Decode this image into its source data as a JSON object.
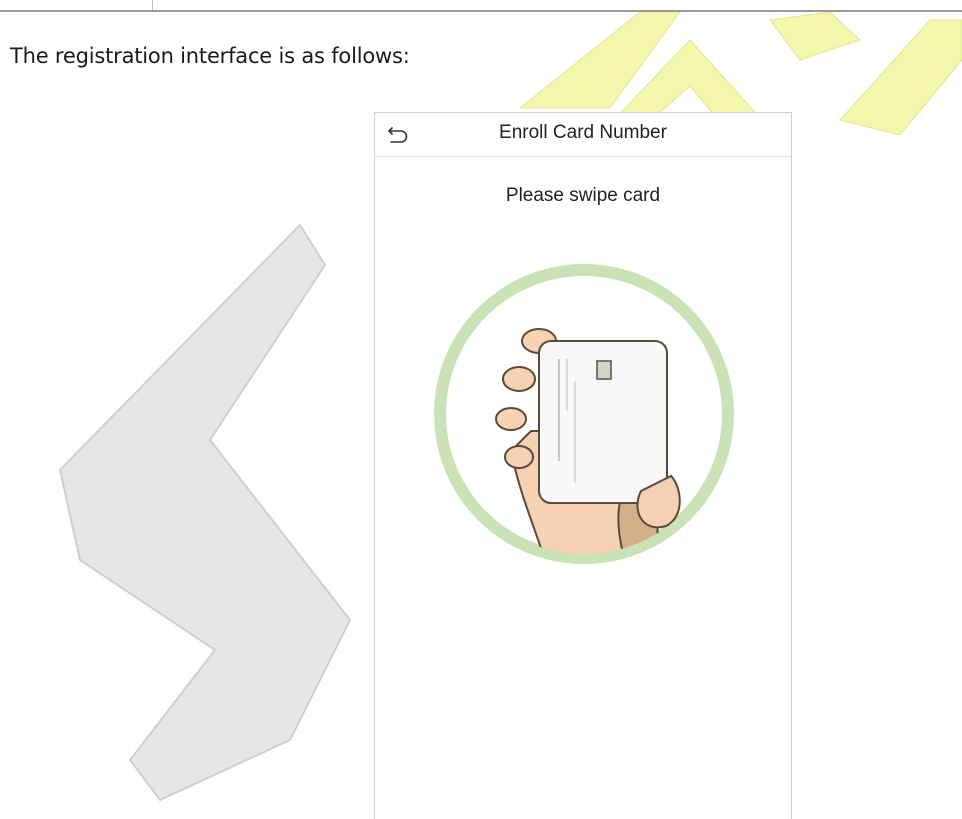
{
  "intro_text": "The registration interface is as follows:",
  "screen": {
    "title": "Enroll Card Number",
    "prompt": "Please swipe card",
    "back_icon": "back-arrow-icon",
    "illustration_icon": "hand-holding-card-icon"
  },
  "colors": {
    "ring": "#c9e2b6",
    "watermark_gray": "#e3e3e3",
    "watermark_yellow": "#f1f7a6",
    "skin": "#f6d2b2",
    "card": "#f7f8f8",
    "chip": "#cfd8c4"
  }
}
